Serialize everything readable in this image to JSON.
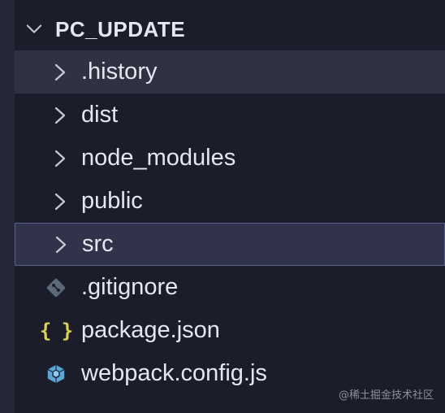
{
  "explorer": {
    "root": {
      "label": "PC_UPDATE",
      "expanded": true
    },
    "folders": [
      {
        "label": ".history",
        "state": "hover"
      },
      {
        "label": "dist",
        "state": "normal"
      },
      {
        "label": "node_modules",
        "state": "normal"
      },
      {
        "label": "public",
        "state": "normal"
      },
      {
        "label": "src",
        "state": "selected"
      }
    ],
    "files": [
      {
        "label": ".gitignore",
        "icon": "git-icon"
      },
      {
        "label": "package.json",
        "icon": "json-braces-icon",
        "glyph": "{ }"
      },
      {
        "label": "webpack.config.js",
        "icon": "webpack-cube-icon"
      }
    ]
  },
  "watermark": "@稀土掘金技术社区",
  "colors": {
    "background": "#1b1d2a",
    "hover": "#2f3243",
    "selected": "#30334a",
    "selected_border": "#5a5f8a",
    "text": "#e6e7ee",
    "json_icon": "#d8d452",
    "webpack_icon": "#5aa6d6",
    "git_icon": "#5c6a78"
  }
}
